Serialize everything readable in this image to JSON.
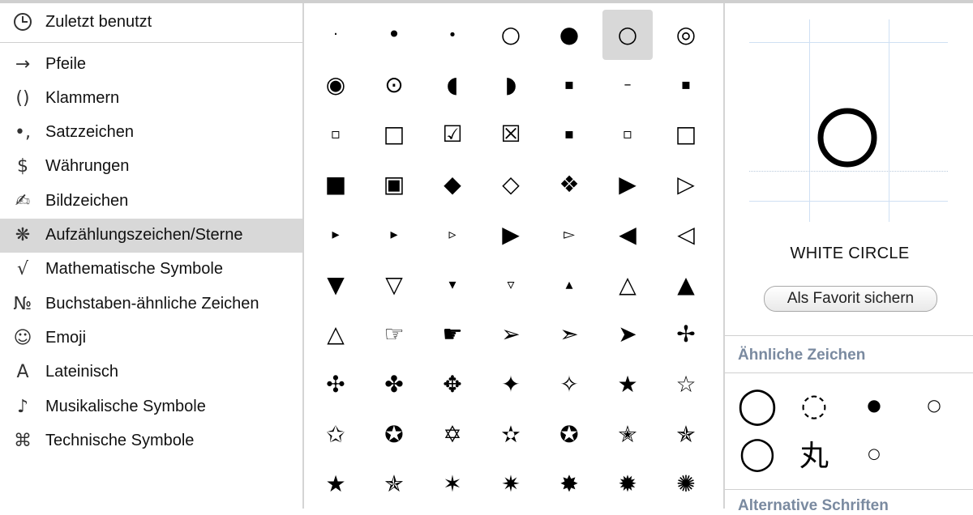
{
  "sidebar": {
    "recent": {
      "label": "Zuletzt benutzt",
      "icon": "clock-icon"
    },
    "items": [
      {
        "glyph": "→",
        "label": "Pfeile",
        "icon": "arrow-icon"
      },
      {
        "glyph": "()",
        "label": "Klammern",
        "icon": "parentheses-icon"
      },
      {
        "glyph": "•,",
        "label": "Satzzeichen",
        "icon": "punctuation-icon"
      },
      {
        "glyph": "$",
        "label": "Währungen",
        "icon": "dollar-icon"
      },
      {
        "glyph": "✍",
        "label": "Bildzeichen",
        "icon": "writing-hand-icon"
      },
      {
        "glyph": "❋",
        "label": "Aufzählungszeichen/Sterne",
        "icon": "asterisk-icon",
        "selected": true
      },
      {
        "glyph": "√",
        "label": "Mathematische Symbole",
        "icon": "square-root-icon"
      },
      {
        "glyph": "№",
        "label": "Buchstaben-ähnliche Zeichen",
        "icon": "numero-icon"
      },
      {
        "glyph": "☺",
        "label": "Emoji",
        "icon": "smiley-icon"
      },
      {
        "glyph": "A",
        "label": "Lateinisch",
        "icon": "letter-a-icon"
      },
      {
        "glyph": "♪",
        "label": "Musikalische Symbole",
        "icon": "music-note-icon"
      },
      {
        "glyph": "⌘",
        "label": "Technische Symbole",
        "icon": "command-icon"
      }
    ]
  },
  "grid": {
    "selected_index": 5,
    "rows": [
      [
        "·",
        "•",
        "∙",
        "○",
        "●",
        "○",
        "◎"
      ],
      [
        "◉",
        "⊙",
        "◖",
        "◗",
        "▪",
        "–",
        "▪"
      ],
      [
        "▫",
        "□",
        "☑",
        "☒",
        "▪",
        "▫",
        "□"
      ],
      [
        "■",
        "▣",
        "◆",
        "◇",
        "❖",
        "▶",
        "▷"
      ],
      [
        "▸",
        "▸",
        "▹",
        "▶",
        "▻",
        "◀",
        "◁"
      ],
      [
        "▼",
        "▽",
        "▾",
        "▿",
        "▴",
        "△",
        "▲"
      ],
      [
        "△",
        "☞",
        "☛",
        "➢",
        "➣",
        "➤",
        "✢"
      ],
      [
        "✣",
        "✤",
        "✥",
        "✦",
        "✧",
        "★",
        "☆"
      ],
      [
        "✩",
        "✪",
        "✡",
        "✫",
        "✪",
        "✭",
        "✯"
      ],
      [
        "★",
        "✯",
        "✶",
        "✷",
        "✸",
        "✹",
        "✺"
      ]
    ]
  },
  "detail": {
    "preview_glyph": "○",
    "char_name": "WHITE CIRCLE",
    "favorite_button": "Als Favorit sichern",
    "similar_heading": "Ähnliche Zeichen",
    "similar": [
      "◯",
      "◌",
      "●",
      "○",
      "◯",
      "丸",
      "○"
    ],
    "alt_fonts_heading": "Alternative Schriften"
  }
}
